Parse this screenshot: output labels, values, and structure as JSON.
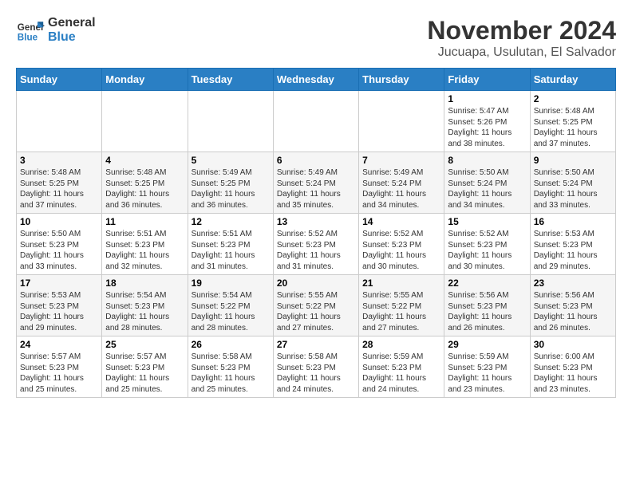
{
  "logo": {
    "line1": "General",
    "line2": "Blue"
  },
  "title": "November 2024",
  "location": "Jucuapa, Usulutan, El Salvador",
  "weekdays": [
    "Sunday",
    "Monday",
    "Tuesday",
    "Wednesday",
    "Thursday",
    "Friday",
    "Saturday"
  ],
  "weeks": [
    [
      {
        "day": "",
        "info": ""
      },
      {
        "day": "",
        "info": ""
      },
      {
        "day": "",
        "info": ""
      },
      {
        "day": "",
        "info": ""
      },
      {
        "day": "",
        "info": ""
      },
      {
        "day": "1",
        "info": "Sunrise: 5:47 AM\nSunset: 5:26 PM\nDaylight: 11 hours and 38 minutes."
      },
      {
        "day": "2",
        "info": "Sunrise: 5:48 AM\nSunset: 5:25 PM\nDaylight: 11 hours and 37 minutes."
      }
    ],
    [
      {
        "day": "3",
        "info": "Sunrise: 5:48 AM\nSunset: 5:25 PM\nDaylight: 11 hours and 37 minutes."
      },
      {
        "day": "4",
        "info": "Sunrise: 5:48 AM\nSunset: 5:25 PM\nDaylight: 11 hours and 36 minutes."
      },
      {
        "day": "5",
        "info": "Sunrise: 5:49 AM\nSunset: 5:25 PM\nDaylight: 11 hours and 36 minutes."
      },
      {
        "day": "6",
        "info": "Sunrise: 5:49 AM\nSunset: 5:24 PM\nDaylight: 11 hours and 35 minutes."
      },
      {
        "day": "7",
        "info": "Sunrise: 5:49 AM\nSunset: 5:24 PM\nDaylight: 11 hours and 34 minutes."
      },
      {
        "day": "8",
        "info": "Sunrise: 5:50 AM\nSunset: 5:24 PM\nDaylight: 11 hours and 34 minutes."
      },
      {
        "day": "9",
        "info": "Sunrise: 5:50 AM\nSunset: 5:24 PM\nDaylight: 11 hours and 33 minutes."
      }
    ],
    [
      {
        "day": "10",
        "info": "Sunrise: 5:50 AM\nSunset: 5:23 PM\nDaylight: 11 hours and 33 minutes."
      },
      {
        "day": "11",
        "info": "Sunrise: 5:51 AM\nSunset: 5:23 PM\nDaylight: 11 hours and 32 minutes."
      },
      {
        "day": "12",
        "info": "Sunrise: 5:51 AM\nSunset: 5:23 PM\nDaylight: 11 hours and 31 minutes."
      },
      {
        "day": "13",
        "info": "Sunrise: 5:52 AM\nSunset: 5:23 PM\nDaylight: 11 hours and 31 minutes."
      },
      {
        "day": "14",
        "info": "Sunrise: 5:52 AM\nSunset: 5:23 PM\nDaylight: 11 hours and 30 minutes."
      },
      {
        "day": "15",
        "info": "Sunrise: 5:52 AM\nSunset: 5:23 PM\nDaylight: 11 hours and 30 minutes."
      },
      {
        "day": "16",
        "info": "Sunrise: 5:53 AM\nSunset: 5:23 PM\nDaylight: 11 hours and 29 minutes."
      }
    ],
    [
      {
        "day": "17",
        "info": "Sunrise: 5:53 AM\nSunset: 5:23 PM\nDaylight: 11 hours and 29 minutes."
      },
      {
        "day": "18",
        "info": "Sunrise: 5:54 AM\nSunset: 5:23 PM\nDaylight: 11 hours and 28 minutes."
      },
      {
        "day": "19",
        "info": "Sunrise: 5:54 AM\nSunset: 5:22 PM\nDaylight: 11 hours and 28 minutes."
      },
      {
        "day": "20",
        "info": "Sunrise: 5:55 AM\nSunset: 5:22 PM\nDaylight: 11 hours and 27 minutes."
      },
      {
        "day": "21",
        "info": "Sunrise: 5:55 AM\nSunset: 5:22 PM\nDaylight: 11 hours and 27 minutes."
      },
      {
        "day": "22",
        "info": "Sunrise: 5:56 AM\nSunset: 5:23 PM\nDaylight: 11 hours and 26 minutes."
      },
      {
        "day": "23",
        "info": "Sunrise: 5:56 AM\nSunset: 5:23 PM\nDaylight: 11 hours and 26 minutes."
      }
    ],
    [
      {
        "day": "24",
        "info": "Sunrise: 5:57 AM\nSunset: 5:23 PM\nDaylight: 11 hours and 25 minutes."
      },
      {
        "day": "25",
        "info": "Sunrise: 5:57 AM\nSunset: 5:23 PM\nDaylight: 11 hours and 25 minutes."
      },
      {
        "day": "26",
        "info": "Sunrise: 5:58 AM\nSunset: 5:23 PM\nDaylight: 11 hours and 25 minutes."
      },
      {
        "day": "27",
        "info": "Sunrise: 5:58 AM\nSunset: 5:23 PM\nDaylight: 11 hours and 24 minutes."
      },
      {
        "day": "28",
        "info": "Sunrise: 5:59 AM\nSunset: 5:23 PM\nDaylight: 11 hours and 24 minutes."
      },
      {
        "day": "29",
        "info": "Sunrise: 5:59 AM\nSunset: 5:23 PM\nDaylight: 11 hours and 23 minutes."
      },
      {
        "day": "30",
        "info": "Sunrise: 6:00 AM\nSunset: 5:23 PM\nDaylight: 11 hours and 23 minutes."
      }
    ]
  ]
}
